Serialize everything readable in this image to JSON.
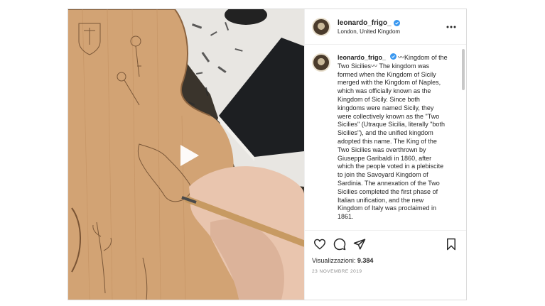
{
  "post": {
    "username": "leonardo_frigo_",
    "location": "London, United Kingdom",
    "verified": true,
    "caption_user": "leonardo_frigo_",
    "caption_text": "〰Kingdom of the Two Sicilies〰 The kingdom was formed when the Kingdom of Sicily merged with the Kingdom of Naples, which was officially known as the Kingdom of Sicily. Since both kingdoms were named Sicily, they were collectively known as the \"Two Sicilies\" (Utraque Sicilia, literally \"both Sicilies\"), and the unified kingdom adopted this name. The King of the Two Sicilies was overthrown by Giuseppe Garibaldi in 1860, after which the people voted in a plebiscite to join the Savoyard Kingdom of Sardinia. The annexation of the Two Sicilies completed the first phase of Italian unification, and the new Kingdom of Italy was proclaimed in 1861.",
    "views_label": "Visualizzazioni:",
    "views_count": "9.384",
    "date": "23 NOVEMBRE 2019"
  },
  "icons": {
    "more": "more-horizontal-icon",
    "like": "heart-icon",
    "comment": "comment-icon",
    "share": "send-icon",
    "save": "bookmark-icon",
    "play": "play-icon",
    "verified": "verified-badge-icon"
  },
  "colors": {
    "verified": "#3897f0",
    "text": "#262626",
    "muted": "#8e8e8e",
    "border": "#dbdbdb"
  }
}
